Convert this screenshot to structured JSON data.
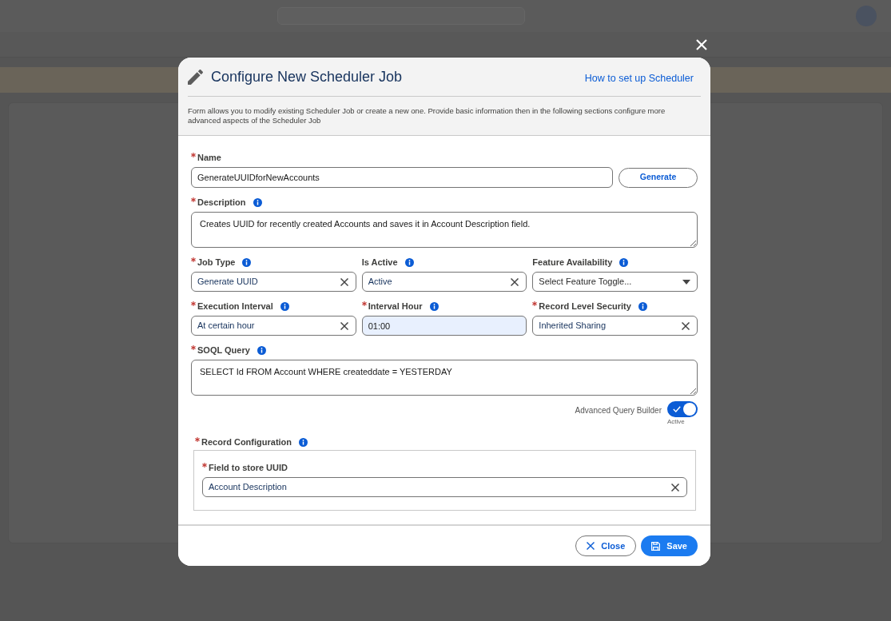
{
  "dialog": {
    "title": "Configure New Scheduler Job",
    "help_link": "How to set up Scheduler",
    "intro": "Form allows you to modify existing Scheduler Job or create a new one. Provide basic information then in the following sections configure more advanced aspects of the Scheduler Job"
  },
  "form": {
    "name": {
      "label": "Name",
      "required": true,
      "info_icon": false,
      "kind": "input",
      "value": "GenerateUUIDforNewAccounts",
      "action": "Generate"
    },
    "description": {
      "label": "Description",
      "required": true,
      "info_icon": true,
      "kind": "textarea",
      "value": "Creates UUID for recently created Accounts and saves it in Account Description field."
    },
    "rows": [
      {
        "fields": [
          {
            "label": "Job Type",
            "required": true,
            "info_icon": true,
            "kind": "combobox",
            "value": "Generate UUID"
          },
          {
            "label": "Is Active",
            "required": false,
            "info_icon": true,
            "kind": "combobox",
            "value": "Active"
          },
          {
            "label": "Feature Availability",
            "required": false,
            "info_icon": true,
            "kind": "select",
            "placeholder": "Select Feature Toggle..."
          }
        ]
      },
      {
        "fields": [
          {
            "label": "Execution Interval",
            "required": true,
            "info_icon": true,
            "kind": "combobox",
            "value": "At certain hour"
          },
          {
            "label": "Interval Hour",
            "required": true,
            "info_icon": true,
            "kind": "time",
            "value": "01:00"
          },
          {
            "label": "Record Level Security",
            "required": true,
            "info_icon": true,
            "kind": "combobox",
            "value": "Inherited Sharing"
          }
        ]
      }
    ],
    "soql_query": {
      "label": "SOQL Query",
      "required": true,
      "info_icon": true,
      "kind": "textarea",
      "value": "SELECT Id FROM Account WHERE createddate = YESTERDAY"
    },
    "advanced_query_builder": {
      "label": "Advanced Query Builder",
      "on": true,
      "status": "Active"
    },
    "record_configuration": {
      "label": "Record Configuration",
      "required": true,
      "info_icon": true,
      "fields": [
        {
          "label": "Field to store UUID",
          "required": true,
          "info_icon": false,
          "kind": "combobox",
          "value": "Account Description"
        }
      ]
    }
  },
  "footer": {
    "buttons": [
      {
        "label": "Close",
        "kind": "close"
      },
      {
        "label": "Save",
        "kind": "save"
      }
    ]
  }
}
